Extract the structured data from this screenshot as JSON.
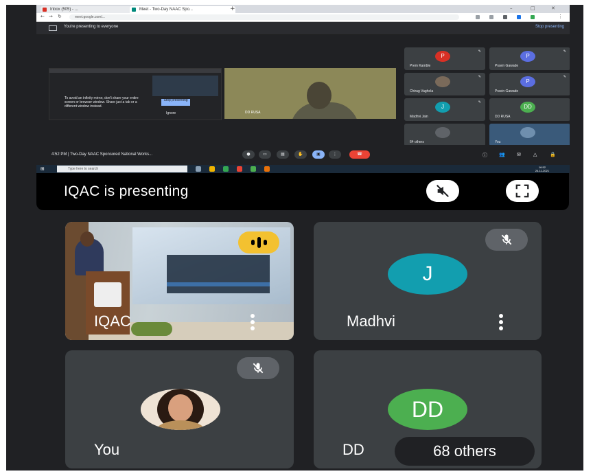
{
  "browser": {
    "tabs": [
      {
        "label": "Inbox (505) - ...",
        "color": "#d93025"
      },
      {
        "label": "Meet - Two-Day NAAC Spo...",
        "color": "#00897b"
      }
    ],
    "url": "meet.google.com/..."
  },
  "presenting_bar": {
    "text": "You're presenting to everyone",
    "stop_label": "Stop presenting"
  },
  "shared_screen": {
    "message": "To avoid an infinity mirror, don't share your entire screen or browser window. Share just a tab or a different window instead.",
    "stop_label": "Stop presenting",
    "ignore_label": "Ignore",
    "video_name": "DD RUSA"
  },
  "mini_participants": [
    {
      "name": "Prem Kamble",
      "initial": "P",
      "color": "#d93025"
    },
    {
      "name": "Pravin Gawade",
      "initial": "P",
      "color": "#5b6ee1"
    },
    {
      "name": "Chirag Vaghela",
      "initial": "",
      "color": "#7a6a5a"
    },
    {
      "name": "Pravin Gawade",
      "initial": "P",
      "color": "#5b6ee1"
    },
    {
      "name": "Madhvi Jain",
      "initial": "J",
      "color": "#129eaf"
    },
    {
      "name": "DD RUSA",
      "initial": "DD",
      "color": "#4caf50"
    },
    {
      "name": "64 others",
      "initial": "",
      "color": "#5f6368"
    },
    {
      "name": "You",
      "initial": "",
      "color": "#3a5a7a"
    }
  ],
  "meeting_bar": {
    "time_title": "4:52 PM  |  Two-Day NAAC Sponsored National Works...",
    "more_options": "More options"
  },
  "taskbar": {
    "search_placeholder": "Type here to search",
    "clock_time": "16:52",
    "clock_date": "24-11-2021"
  },
  "banner": {
    "title": "IQAC is presenting"
  },
  "tiles": {
    "iqac": {
      "name": "IQAC"
    },
    "madhvi": {
      "name": "Madhvi",
      "initial": "J",
      "color": "#129eaf"
    },
    "you": {
      "name": "You"
    },
    "dd": {
      "name": "DD",
      "initial": "DD",
      "color": "#4caf50"
    },
    "others_label": "68 others"
  },
  "icons": [
    "mute-icon",
    "fullscreen-icon",
    "more-vert-icon",
    "mic-off-icon",
    "speaking-indicator-icon"
  ]
}
